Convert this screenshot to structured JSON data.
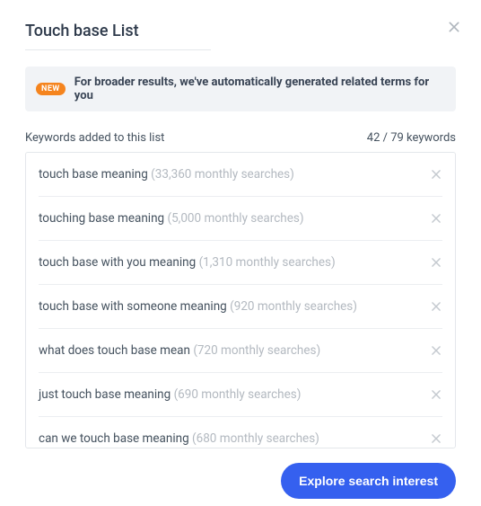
{
  "modal": {
    "title": "Touch base List"
  },
  "banner": {
    "badge": "NEW",
    "text": "For broader results, we've automatically generated related terms for you"
  },
  "list": {
    "label": "Keywords added to this list",
    "count_text": "42 / 79 keywords"
  },
  "keywords": [
    {
      "term": "touch base meaning",
      "stats": "(33,360 monthly searches)"
    },
    {
      "term": "touching base meaning",
      "stats": "(5,000 monthly searches)"
    },
    {
      "term": "touch base with you meaning",
      "stats": "(1,310 monthly searches)"
    },
    {
      "term": "touch base with someone meaning",
      "stats": "(920 monthly searches)"
    },
    {
      "term": "what does touch base mean",
      "stats": "(720 monthly searches)"
    },
    {
      "term": "just touch base meaning",
      "stats": "(690 monthly searches)"
    },
    {
      "term": "can we touch base meaning",
      "stats": "(680 monthly searches)"
    }
  ],
  "cta": {
    "label": "Explore search interest"
  }
}
